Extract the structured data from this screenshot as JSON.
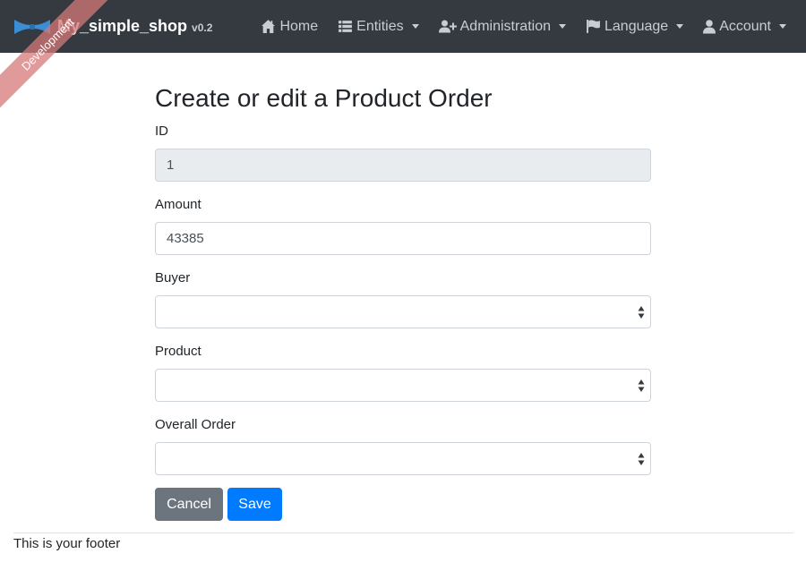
{
  "navbar": {
    "brand": {
      "name": "My_simple_shop",
      "version": "v0.2"
    },
    "items": [
      {
        "label": "Home",
        "icon": "home-icon",
        "dropdown": false
      },
      {
        "label": "Entities",
        "icon": "list-icon",
        "dropdown": true
      },
      {
        "label": "Administration",
        "icon": "user-plus-icon",
        "dropdown": true
      },
      {
        "label": "Language",
        "icon": "flag-icon",
        "dropdown": true
      },
      {
        "label": "Account",
        "icon": "user-icon",
        "dropdown": true
      }
    ]
  },
  "ribbon": {
    "text": "Development"
  },
  "form": {
    "title": "Create or edit a Product Order",
    "id": {
      "label": "ID",
      "value": "1"
    },
    "amount": {
      "label": "Amount",
      "value": "43385"
    },
    "buyer": {
      "label": "Buyer",
      "value": ""
    },
    "product": {
      "label": "Product",
      "value": ""
    },
    "overall_order": {
      "label": "Overall Order",
      "value": ""
    },
    "cancel_label": "Cancel",
    "save_label": "Save"
  },
  "footer": {
    "text": "This is your footer"
  },
  "colors": {
    "navbar_bg": "#343a40",
    "primary": "#007bff",
    "secondary": "#6c757d",
    "ribbon": "#d67878"
  }
}
